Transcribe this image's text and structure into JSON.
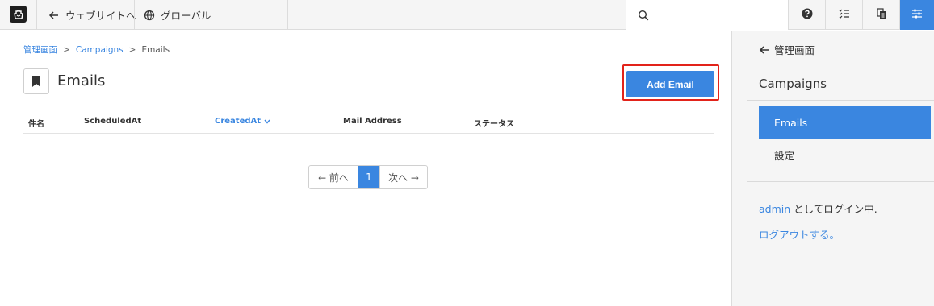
{
  "topbar": {
    "back_label": "ウェブサイトへ",
    "global_label": "グローバル",
    "search_placeholder": ""
  },
  "breadcrumb": [
    "管理画面",
    "Campaigns",
    "Emails"
  ],
  "breadcrumb_sep": ">",
  "page": {
    "title": "Emails",
    "add_button": "Add Email"
  },
  "table": {
    "headers": [
      "件名",
      "ScheduledAt",
      "CreatedAt",
      "Mail Address",
      "ステータス"
    ],
    "sorted_column": "CreatedAt",
    "sort_direction": "descending"
  },
  "pagination": {
    "prev": "← 前へ",
    "current": "1",
    "next": "次へ →"
  },
  "sidebar": {
    "back_label": "管理画面",
    "heading": "Campaigns",
    "items": [
      {
        "label": "Emails",
        "active": true
      },
      {
        "label": "設定",
        "active": false
      }
    ],
    "login_user": "admin",
    "login_suffix": " としてログイン中.",
    "logout": "ログアウトする。"
  },
  "colors": {
    "accent": "#3a86e0",
    "highlight": "#e2231a"
  }
}
